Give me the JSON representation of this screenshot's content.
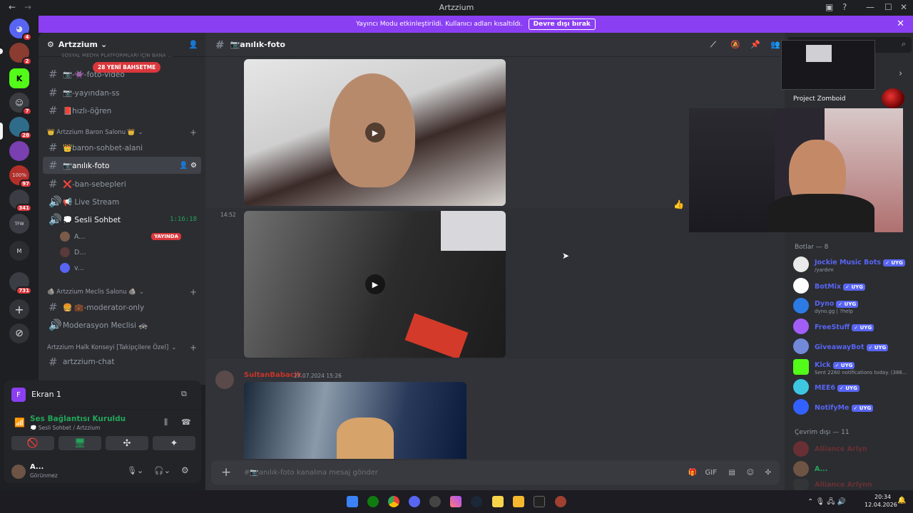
{
  "window": {
    "title": "Artzzium"
  },
  "banner": {
    "text": "Yayıncı Modu etkinleştirildi. Kullanıcı adları kısaltıldı.",
    "button": "Devre dışı bırak"
  },
  "guilds": {
    "badges": [
      "4",
      "2",
      "7",
      "28",
      "97",
      "341",
      "731"
    ],
    "labels": [
      "100%",
      "TFW",
      "M"
    ]
  },
  "server": {
    "name": "Artzzium",
    "truncated_header": "SOSYAL MEDYA PLATFORMLARI İÇİN BANA ...",
    "mention_pill": "28 YENİ BAHSETME"
  },
  "channels": {
    "top": [
      {
        "name": "📷-👾-foto-video"
      },
      {
        "name": "📷-yayından-ss"
      },
      {
        "name": "📕hızlı-öğren"
      }
    ],
    "cat1": "👑 Artzzium Baron Salonu 👑",
    "cat1_items": [
      {
        "name": "👑baron-sohbet-alani"
      },
      {
        "name": "📷anılık-foto"
      },
      {
        "name": "❌-ban-sebepleri"
      },
      {
        "name": "📢 Live Stream"
      },
      {
        "name": "💭 Sesli Sohbet",
        "time": "1:16:18"
      }
    ],
    "voice_users": [
      {
        "name": "A...",
        "live": "YAYINDA"
      },
      {
        "name": "D..."
      },
      {
        "name": "v..."
      }
    ],
    "cat2": "🪨 Artzzium Meclis Salonu 🪨",
    "cat2_items": [
      {
        "name": "🍔 💼-moderator-only"
      },
      {
        "name": "Moderasyon Meclisi 🚓"
      }
    ],
    "cat3": "Artzzium Halk Konseyi [Takipçilere Özel]",
    "cat3_items": [
      {
        "name": "artzzium-chat"
      }
    ]
  },
  "screen_panel": {
    "title": "Ekran 1",
    "status": "Ses Bağlantısı Kuruldu",
    "location": "💭 Sesli Sohbet / Artzzium"
  },
  "user": {
    "name": "A...",
    "status": "Görünmez"
  },
  "chat": {
    "channel": "📷anılık-foto",
    "time1": "14:52",
    "author": "SultanBabacik",
    "timestamp": "27.07.2024 15:26",
    "composer_placeholder": "#📷anılık-foto kanalına mesaj gönder"
  },
  "members": {
    "pip_label": "Project Zomboid",
    "bots_title": "Botlar — 8",
    "bots": [
      {
        "name": "Jockie Music Bots",
        "sub": "/yardım",
        "color": "#eaeaea"
      },
      {
        "name": "BotMix",
        "sub": "",
        "color": "#ffffff"
      },
      {
        "name": "Dyno",
        "sub": "dyno.gg | ?help",
        "color": "#2c7be5"
      },
      {
        "name": "FreeStuff",
        "sub": "",
        "color": "#a15ef7"
      },
      {
        "name": "GiveawayBot",
        "sub": "",
        "color": "#7289da"
      },
      {
        "name": "Kick",
        "sub": "Sent 2260 notifications today. (388...",
        "color": "#53fc18"
      },
      {
        "name": "MEE6",
        "sub": "",
        "color": "#3dc7e0"
      },
      {
        "name": "NotifyMe",
        "sub": "",
        "color": "#3361ff"
      }
    ],
    "bot_tag": "✓ UYG",
    "offline_title": "Çevrim dışı — 11",
    "offline": [
      {
        "name": "Alliance Arlyn"
      },
      {
        "name": "A..."
      },
      {
        "name": "Alliance Arlynn"
      }
    ]
  },
  "taskbar": {
    "time": "20:34",
    "date": "12.04.2026"
  }
}
